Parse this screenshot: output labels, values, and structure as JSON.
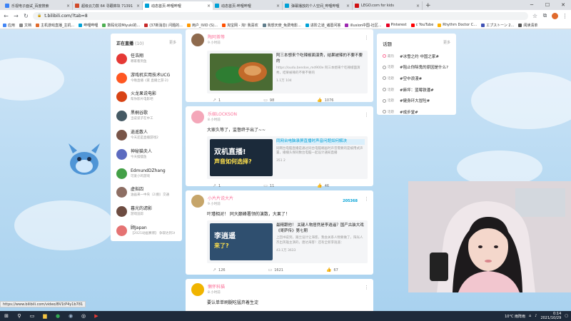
{
  "browser": {
    "tabs": [
      {
        "label": "乐视电子面试_百度搜索",
        "color": "#3b82f6",
        "active": false
      },
      {
        "label": "超级云力款 64 寻跟棉块 71391",
        "color": "#d14a2a",
        "active": false
      },
      {
        "label": "动态首页-哔哩哔哩",
        "color": "#00a1d6",
        "active": true
      },
      {
        "label": "动态首页-哔哩哔哩",
        "color": "#00a1d6",
        "active": false
      },
      {
        "label": "弹幕播放的个人空间_哔哩哔哩",
        "color": "#00a1d6",
        "active": false
      },
      {
        "label": "LEGO.com for kids",
        "color": "#d01012",
        "active": false
      }
    ],
    "url": "t.bilibili.com/?tab=8",
    "bookmarks": [
      {
        "label": "应用",
        "color": "#4285f4"
      },
      {
        "label": "文档",
        "color": "#888"
      },
      {
        "label": "主机游戏直播_主机...",
        "color": "#e06a2c"
      },
      {
        "label": "哔哩哔哩",
        "color": "#00a1d6"
      },
      {
        "label": "数码化妆Miyuki的...",
        "color": "#4caf50"
      },
      {
        "label": "(37新消息) 问题的...",
        "color": "#c62828"
      },
      {
        "label": "用户_IVID (S)...",
        "color": "#ff9800"
      },
      {
        "label": "淘宝网 - 淘! 我喜欢",
        "color": "#ff5000"
      },
      {
        "label": "我想天使_免费电影...",
        "color": "#607d8b"
      },
      {
        "label": "进阶之道_诸葛问答",
        "color": "#00a1d6"
      },
      {
        "label": "illusion中国-社区...",
        "color": "#9c27b0"
      },
      {
        "label": "Pinterest",
        "color": "#e60023"
      },
      {
        "label": "c YouTube",
        "color": "#ff0000"
      },
      {
        "label": "Rhythm Doctor C...",
        "color": "#ffb300"
      },
      {
        "label": "エプストーン 2...",
        "color": "#3f51b5"
      },
      {
        "label": "阅读清单",
        "color": "#555"
      }
    ],
    "status_url": "https://www.bilibili.com/video/BV1tP4y1b781"
  },
  "live": {
    "title": "正在直播",
    "count": "(10)",
    "more": "更多",
    "items": [
      {
        "name": "任浩翔",
        "sub": "哪家看到鱼",
        "color": "#e53935"
      },
      {
        "name": "游戏机实用技术UCG",
        "sub": "今晚直播《家 直播之游·2》",
        "color": "#ff5722"
      },
      {
        "name": "火龙果说电影",
        "sub": "帮你影片电影吧",
        "color": "#d84315"
      },
      {
        "name": "黑桐谷歌",
        "sub": "当说谎子在中工",
        "color": "#455a64"
      },
      {
        "name": "逍遥散人",
        "sub": "今天还是直播游戏2",
        "color": "#795548"
      },
      {
        "name": "神秘猫夫人",
        "sub": "今天摆摆鱼",
        "color": "#5c6bc0"
      },
      {
        "name": "EdmundDZhang",
        "sub": "可爱小鸡游戏",
        "color": "#43a047"
      },
      {
        "name": "虚拟四",
        "sub": "油画来一中央（2)鲍）交通",
        "color": "#8d6e63"
      },
      {
        "name": "暮光的滤影",
        "sub": "游戏追踪",
        "color": "#6d4c41"
      },
      {
        "name": "顾Japan",
        "sub": "【2021动画赛博】 争取达到1681",
        "color": "#e57373"
      }
    ]
  },
  "feed": [
    {
      "author": "陶阿茶等",
      "time": "9 小时前",
      "text": "",
      "share_title": "阿三本想来个吃辣椒面演秀，结果被辣的不要不要的",
      "share_desc": "https://oudu.bendoe_md900e 阿三本想来个吃辣椒面演秀，结果被辣的不要不要的",
      "share_stats": "1.1万    104",
      "likes": "1",
      "comments": "98",
      "shares": "1076",
      "avatar_color": "#8e6a4d",
      "thumb_color": "#3c5a2b"
    },
    {
      "author": "乐娱LOCKSON",
      "time": "8 小时前",
      "text": "大家久等了，监督终于出了~~",
      "share_title": "同网台电脑录屏直播时声音问题如何解决",
      "share_desc": "同网台电脑直播是通过同台电脑端画时声音需要的是被用式声置，播播头保同数台电脑一起设计通知直播",
      "share_stats": "351    2",
      "likes": "1",
      "comments": "11",
      "shares": "46",
      "thumb_caption": "双机直播!",
      "thumb_caption2": "声音如何选择?",
      "avatar_color": "#f4a7b9",
      "thumb_color": "#1b2a3a"
    },
    {
      "author": "小片片说大片",
      "badge": "205368",
      "time": "9 小时前",
      "text": "叶瑾相对！ 同大巅峰署领的演数，大果了！",
      "share_title": "最精跟他！ 关键人物居然是李逍遥？国产古装大戏《哥萨传》第七期",
      "share_desc": "上回书说到，跟兰设计让海客，我会关系人物要做了，阳光人杰出英雄主演的，唐达海客！还有全新李逍遥：",
      "share_stats": "43.1万    3633",
      "likes": "126",
      "comments": "1621",
      "shares": "67",
      "thumb_caption": "李逍遥",
      "thumb_caption2": "来了?",
      "avatar_color": "#c6a56a",
      "thumb_color": "#2f4f6f"
    },
    {
      "author": "懒怀科猫",
      "time": "8 小时前",
      "text": "要认单单刷腿吃猛弃着生淀",
      "avatar_color": "#f0b400"
    }
  ],
  "topics": {
    "title": "话题",
    "more": "更多",
    "items": [
      {
        "tag": "最热",
        "label": "#冰雪之约 中国之家#"
      },
      {
        "tag": "话题",
        "label": "#阻止你除鬼的原因是什么?"
      },
      {
        "tag": "话题",
        "label": "#空中浪漫#"
      },
      {
        "tag": "话题",
        "label": "#麻坪：蓝莓铁潘#"
      },
      {
        "tag": "话题",
        "label": "#健身环大冒险#"
      },
      {
        "tag": "话题",
        "label": "#成步堂#"
      }
    ]
  },
  "taskbar": {
    "weather": "10°C  雨阵雨",
    "time": "0:14",
    "date": "2021/10/29"
  },
  "colors": {
    "bili_pink": "#fb7299",
    "bili_blue": "#00a1d6"
  }
}
